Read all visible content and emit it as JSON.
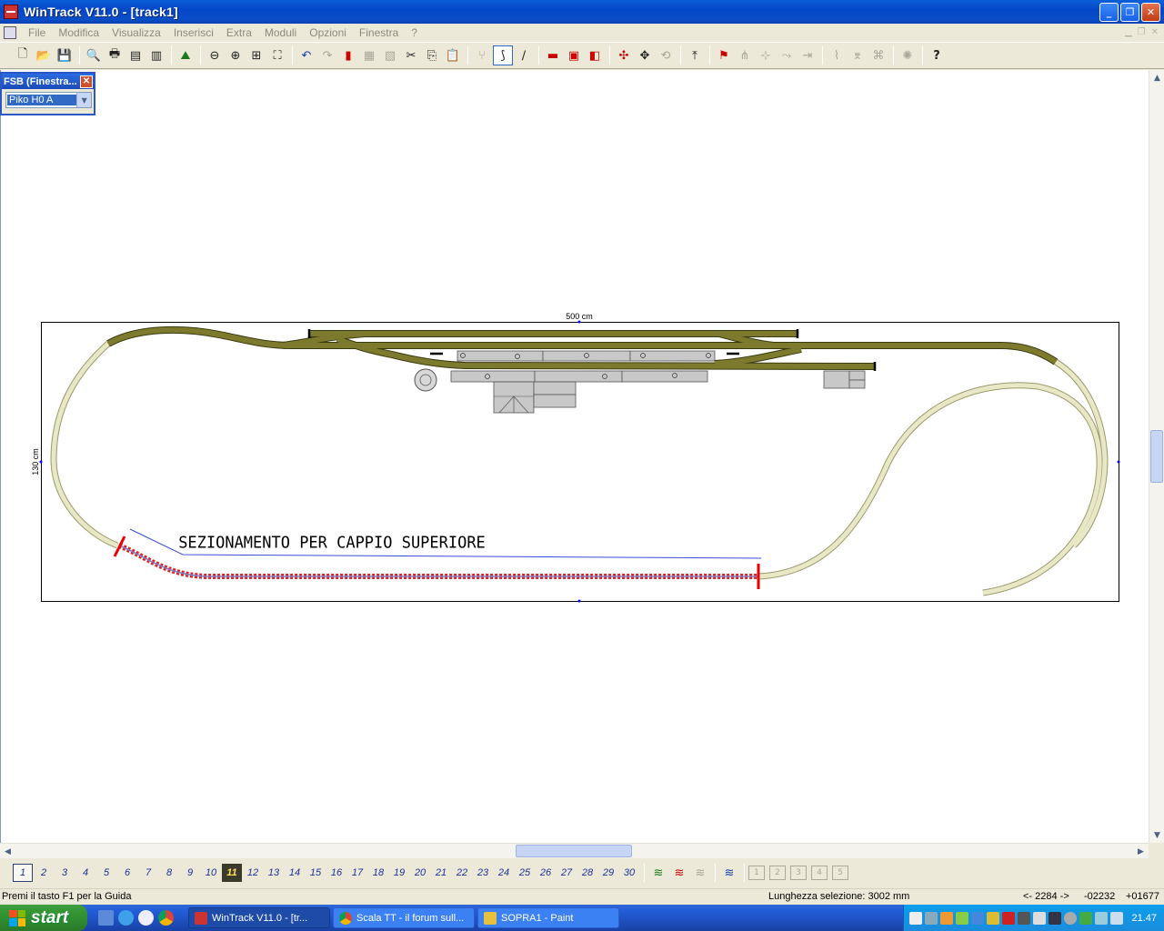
{
  "window": {
    "title": "WinTrack  V11.0 - [track1]",
    "min_glyph": "_",
    "max_glyph": "❐",
    "close_glyph": "✕"
  },
  "menu": [
    "File",
    "Modifica",
    "Visualizza",
    "Inserisci",
    "Extra",
    "Moduli",
    "Opzioni",
    "Finestra",
    "?"
  ],
  "fsb": {
    "title": "FSB (Finestra...",
    "selected": "Piko H0  A"
  },
  "layout": {
    "width_label": "500 cm",
    "height_label": "130 cm",
    "annotation": "SEZIONAMENTO PER CAPPIO SUPERIORE"
  },
  "pages": [
    "1",
    "2",
    "3",
    "4",
    "5",
    "6",
    "7",
    "8",
    "9",
    "10",
    "11",
    "12",
    "13",
    "14",
    "15",
    "16",
    "17",
    "18",
    "19",
    "20",
    "21",
    "22",
    "23",
    "24",
    "25",
    "26",
    "27",
    "28",
    "29",
    "30"
  ],
  "page_boxes": [
    "1",
    "2",
    "3",
    "4",
    "5"
  ],
  "status": {
    "help": "Premi il tasto F1 per la Guida",
    "selection_length": "Lunghezza selezione:  3002 mm",
    "length_value": "<- 2284 ->",
    "x_coord": "-02232",
    "y_coord": "+01677"
  },
  "taskbar": {
    "start": "start",
    "tasks": [
      "WinTrack  V11.0 - [tr...",
      "Scala TT - il forum sull...",
      "SOPRA1 - Paint"
    ],
    "clock": "21.47"
  }
}
